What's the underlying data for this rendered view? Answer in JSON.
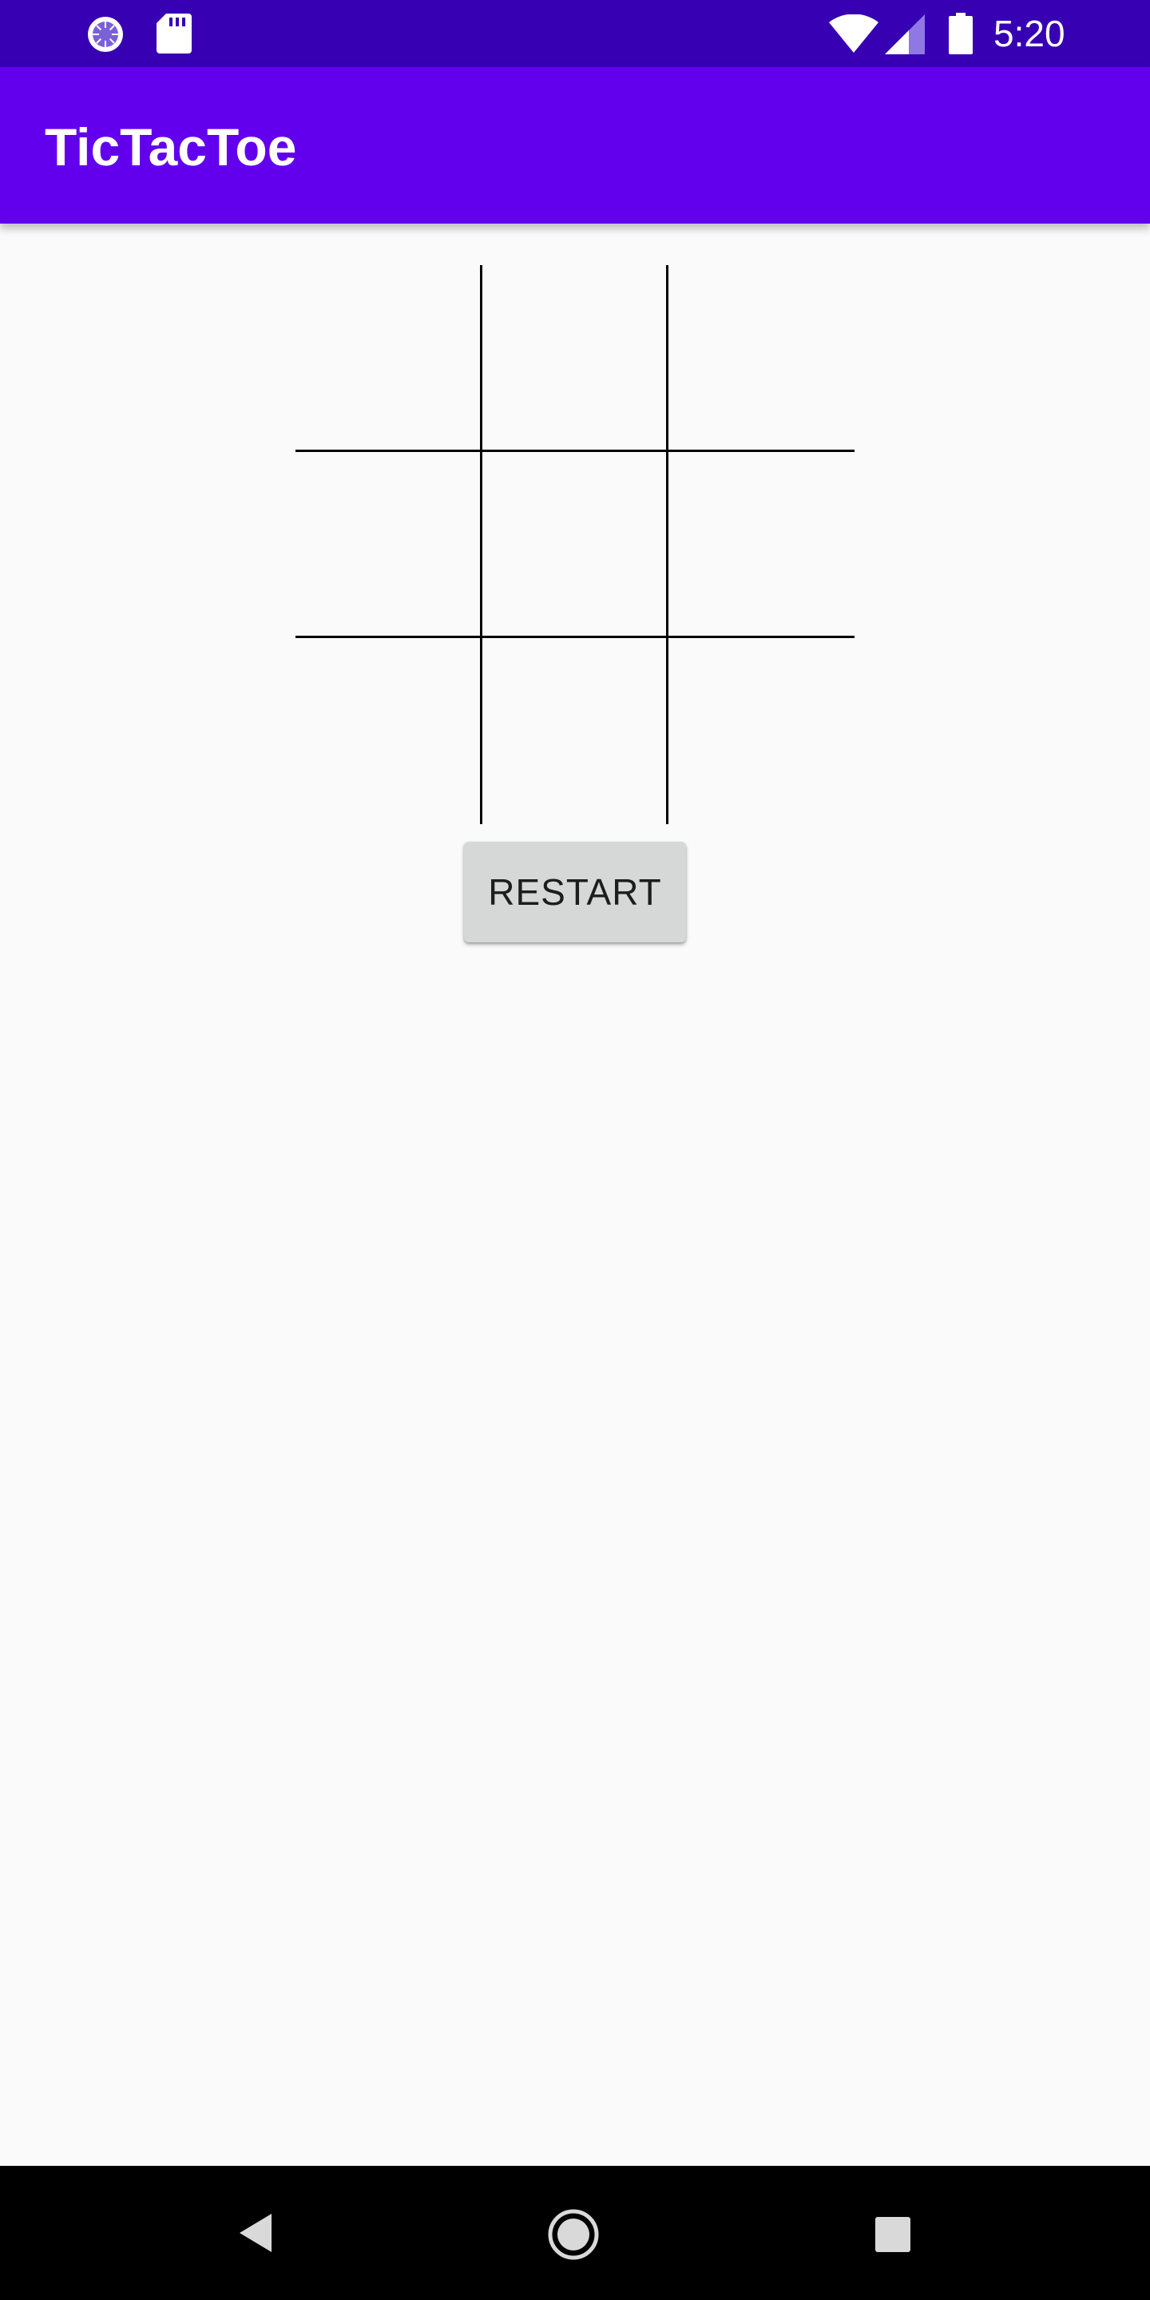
{
  "status_bar": {
    "time": "5:20",
    "background_color": "#3700b3",
    "icons": [
      "sync-icon",
      "sd-card-icon",
      "wifi-icon",
      "cell-signal-icon",
      "battery-icon"
    ]
  },
  "app_bar": {
    "title": "TicTacToe",
    "background_color": "#6200ee"
  },
  "board": {
    "rows": 3,
    "cols": 3,
    "cells": [
      [
        "",
        "",
        ""
      ],
      [
        "",
        "",
        ""
      ],
      [
        "",
        "",
        ""
      ]
    ]
  },
  "restart_button": {
    "label": "RESTART"
  },
  "nav_bar": {
    "buttons": [
      "back-icon",
      "home-icon",
      "recents-icon"
    ]
  }
}
